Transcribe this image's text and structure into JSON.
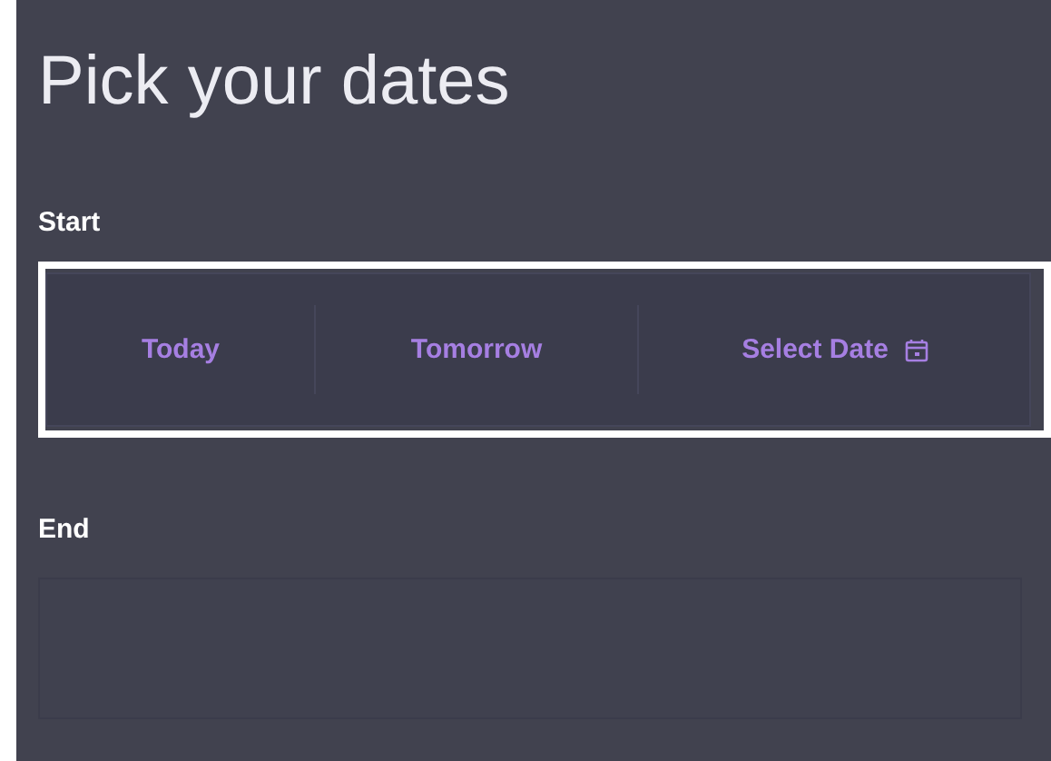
{
  "title": "Pick your dates",
  "start": {
    "label": "Start",
    "focused": true,
    "options": [
      {
        "label": "Today",
        "selected": false,
        "kind": "text"
      },
      {
        "label": "Tomorrow",
        "selected": false,
        "kind": "text"
      },
      {
        "label": "Select Date",
        "selected": false,
        "kind": "calendar"
      }
    ]
  },
  "end": {
    "label": "End"
  }
}
